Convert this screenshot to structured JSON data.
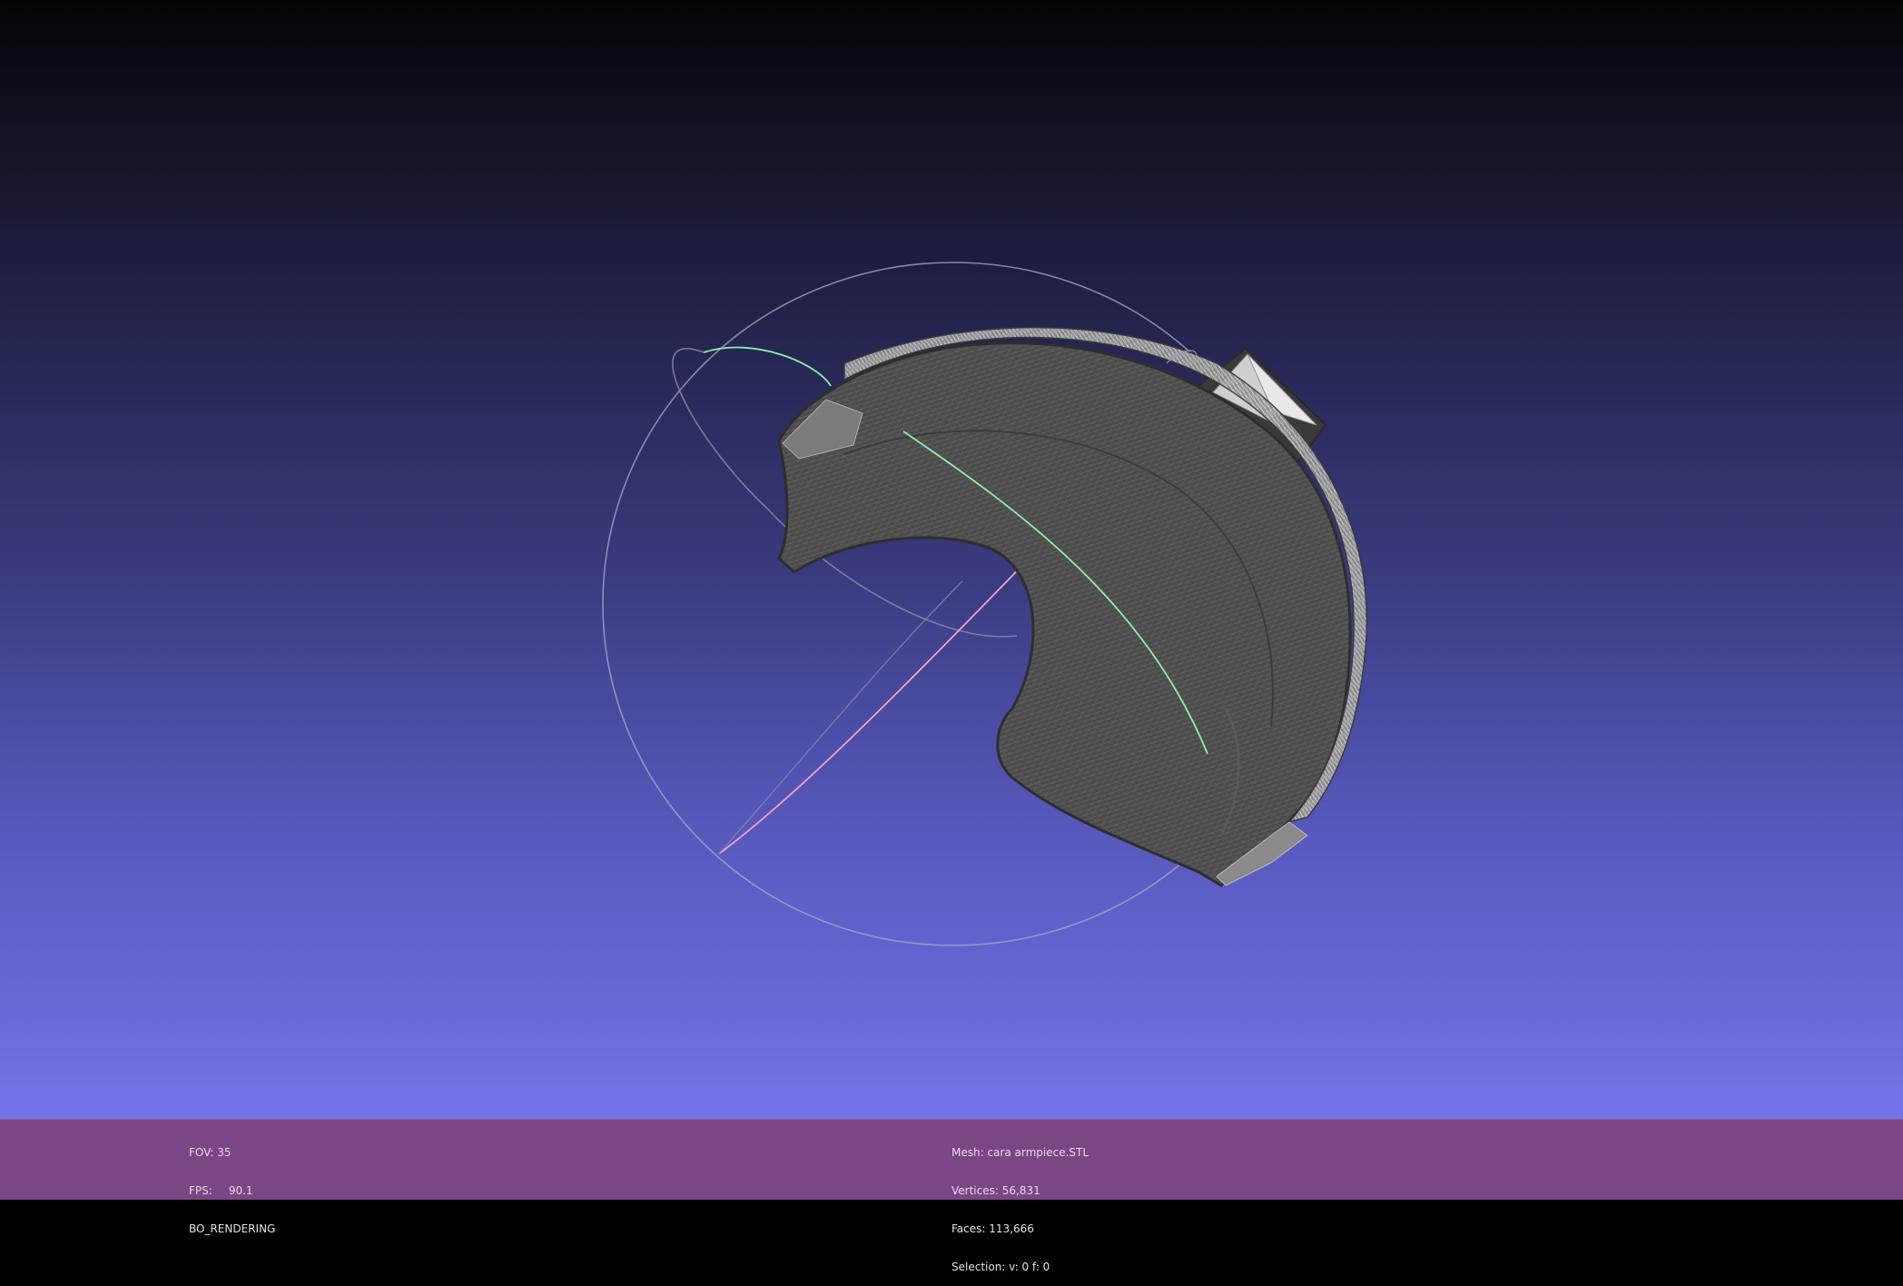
{
  "viewer": {
    "background_top": "#040408",
    "background_bottom": "#7375ea",
    "status_bar_color": "#7c4585"
  },
  "render_info": {
    "fov_label": "FOV: 35",
    "fps_label": "FPS:",
    "fps_value": "90.1",
    "render_mode": "BO_RENDERING"
  },
  "mesh_info": {
    "mesh_label": "Mesh: cara armpiece.STL",
    "vertices_label": "Vertices: 56,831",
    "faces_label": "Faces: 113,666",
    "selection_label": "Selection: v: 0 f: 0"
  },
  "trackball": {
    "ring_color": "#a9a9c7",
    "x_arc_color": "#8ef0a6",
    "y_arc_color": "#f0a2c8"
  },
  "mesh_colors": {
    "surface": "#4c4c4c",
    "edge": "#7a7a7a",
    "rim": "#c9c9c9",
    "outline": "#2e2e2e"
  }
}
